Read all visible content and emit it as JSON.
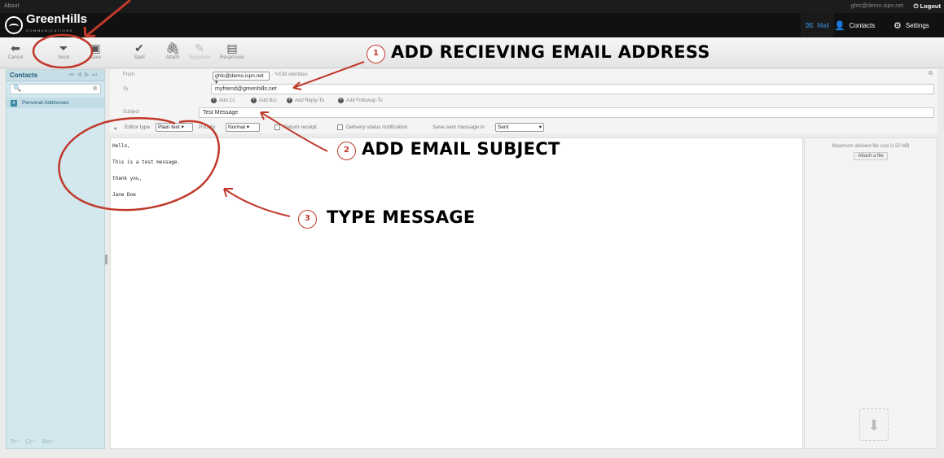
{
  "topbar": {
    "about": "About",
    "account": "ghtc@demo.ispn.net",
    "logout": "Logout"
  },
  "brand": {
    "name": "GreenHills",
    "sub": "COMMUNICATIONS"
  },
  "nav": [
    {
      "label": "Mail",
      "icon": "mail-icon"
    },
    {
      "label": "Contacts",
      "icon": "person-icon"
    },
    {
      "label": "Settings",
      "icon": "gear-icon"
    }
  ],
  "toolbar": {
    "cancel": "Cancel",
    "send": "Send",
    "save": "Save",
    "spell": "Spell",
    "attach": "Attach",
    "signature": "Signature",
    "responses": "Responses"
  },
  "sidebar": {
    "title": "Contacts",
    "group": "Personal Addresses",
    "to_btn": "To",
    "cc_btn": "Cc",
    "bcc_btn": "Bcc"
  },
  "compose": {
    "from_label": "From",
    "from_value": "ghtc@demo.ispn.net",
    "edit_identities": "Edit identities",
    "to_label": "To",
    "to_value": "myfriend@greenhills.net",
    "add_cc": "Add Cc",
    "add_bcc": "Add Bcc",
    "add_reply_to": "Add Reply-To",
    "add_followup_to": "Add Followup-To",
    "subject_label": "Subject",
    "subject_value": "Test Message"
  },
  "options": {
    "editor_type_label": "Editor type",
    "editor_type_value": "Plain text",
    "priority_label": "Priority",
    "priority_value": "Normal",
    "return_receipt": "Return receipt",
    "dsn": "Delivery status notification",
    "save_in_label": "Save sent message in",
    "save_in_value": "Sent"
  },
  "body_lines": [
    "Hello,",
    "This is a test message.",
    "thank you,",
    "Jane Doe"
  ],
  "attachments": {
    "max_size": "Maximum allowed file size is 50 MB",
    "attach_btn": "Attach a file"
  },
  "annotations": [
    {
      "num": "1",
      "text": "ADD RECIEVING EMAIL ADDRESS"
    },
    {
      "num": "2",
      "text": "ADD EMAIL SUBJECT"
    },
    {
      "num": "3",
      "text": "TYPE MESSAGE"
    }
  ],
  "colors": {
    "annotation_red": "#c0392b",
    "header": "#111111",
    "sidebar": "#d2e7ee",
    "mail_active": "#3a8ed8"
  }
}
